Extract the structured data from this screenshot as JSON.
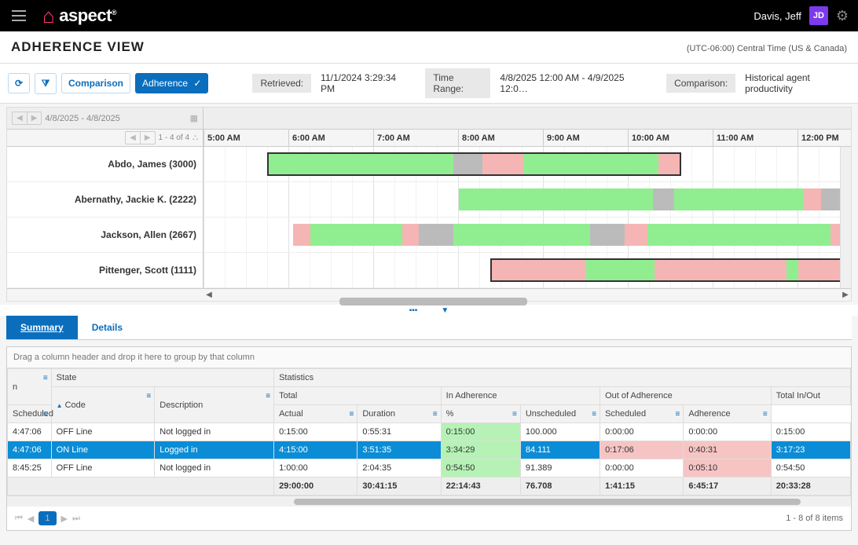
{
  "topbar": {
    "brand": "aspect",
    "user_name": "Davis, Jeff",
    "user_initials": "JD"
  },
  "page": {
    "title": "ADHERENCE VIEW",
    "timezone": "(UTC-06:00) Central Time (US & Canada)"
  },
  "toolbar": {
    "comparison_label": "Comparison",
    "adherence_label": "Adherence",
    "retrieved_label": "Retrieved:",
    "retrieved_value": "11/1/2024 3:29:34 PM",
    "timerange_label": "Time Range:",
    "timerange_value": "4/8/2025 12:00 AM - 4/9/2025 12:0…",
    "comparison2_label": "Comparison:",
    "comparison2_value": "Historical agent productivity"
  },
  "gantt": {
    "date_range": "4/8/2025 - 4/8/2025",
    "page_info": "1 - 4 of 4",
    "hours": [
      "5:00 AM",
      "6:00 AM",
      "7:00 AM",
      "8:00 AM",
      "9:00 AM",
      "10:00 AM",
      "11:00 AM",
      "12:00 PM"
    ],
    "agents": [
      {
        "name": "Abdo, James (3000)"
      },
      {
        "name": "Abernathy, Jackie K. (2222)"
      },
      {
        "name": "Jackson, Allen (2667)"
      },
      {
        "name": "Pittenger, Scott (1111)"
      }
    ]
  },
  "tabs": {
    "summary": "Summary",
    "details": "Details"
  },
  "grid": {
    "group_hint": "Drag a column header and drop it here to group by that column",
    "group_headers": {
      "state": "State",
      "statistics": "Statistics",
      "total": "Total",
      "in_adherence": "In Adherence",
      "out_of_adherence": "Out of Adherence",
      "total_inout": "Total In/Out"
    },
    "col_headers": {
      "time_col": "n",
      "code": "Code",
      "description": "Description",
      "scheduled": "Scheduled",
      "actual": "Actual",
      "duration": "Duration",
      "percent": "%",
      "unscheduled": "Unscheduled",
      "scheduled2": "Scheduled",
      "adherence": "Adherence"
    },
    "rows": [
      {
        "t": "4:47:06",
        "code": "OFF Line",
        "desc": "Not logged in",
        "sched": "0:15:00",
        "actual": "0:55:31",
        "dur": "0:15:00",
        "pct": "100.000",
        "unsch": "0:00:00",
        "sched2": "0:00:00",
        "adh": "0:15:00",
        "sel": false,
        "alt": false,
        "pink_unsch": false,
        "pink_sched2": false
      },
      {
        "t": "4:47:06",
        "code": "ON Line",
        "desc": "Logged in",
        "sched": "4:15:00",
        "actual": "3:51:35",
        "dur": "3:34:29",
        "pct": "84.111",
        "unsch": "0:17:06",
        "sched2": "0:40:31",
        "adh": "3:17:23",
        "sel": true,
        "alt": true,
        "pink_unsch": true,
        "pink_sched2": true
      },
      {
        "t": "8:45:25",
        "code": "OFF Line",
        "desc": "Not logged in",
        "sched": "1:00:00",
        "actual": "2:04:35",
        "dur": "0:54:50",
        "pct": "91.389",
        "unsch": "0:00:00",
        "sched2": "0:05:10",
        "adh": "0:54:50",
        "sel": false,
        "alt": false,
        "pink_unsch": false,
        "pink_sched2": true
      }
    ],
    "footer": {
      "sched": "29:00:00",
      "actual": "30:41:15",
      "dur": "22:14:43",
      "pct": "76.708",
      "unsch": "1:41:15",
      "sched2": "6:45:17",
      "adh": "20:33:28"
    },
    "pager": {
      "current": "1",
      "items": "1 - 8 of 8 items"
    }
  }
}
